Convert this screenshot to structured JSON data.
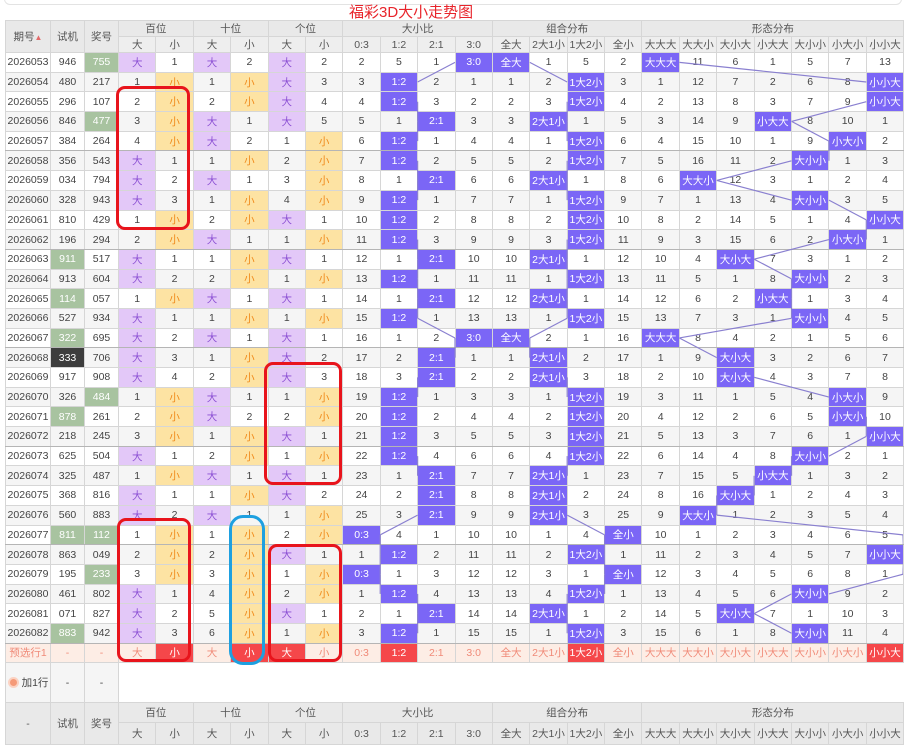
{
  "title": "福彩3D大小走势图",
  "colors": {
    "da_bg": "#e3c8f8",
    "xiao_bg": "#fde3a3",
    "hit": "#7b66f6",
    "pred_selected": "#f5474a",
    "highlight_green": "#a8c3a0",
    "line": "#8a80d0"
  },
  "header": {
    "period": "期号",
    "test": "试机",
    "prize": "奖号",
    "groups": {
      "bai": "百位",
      "shi": "十位",
      "ge": "个位",
      "ratio": "大小比",
      "combo": "组合分布",
      "form": "形态分布"
    },
    "da": "大",
    "xiao": "小",
    "ratio_cols": [
      "0:3",
      "1:2",
      "2:1",
      "3:0"
    ],
    "combo_cols": [
      "全大",
      "2大1小",
      "1大2小",
      "全小"
    ],
    "form_cols": [
      "大大大",
      "大大小",
      "大小大",
      "小大大",
      "大小小",
      "小大小",
      "小小大"
    ],
    "sort_icon": "sort-arrows-icon"
  },
  "rows": [
    {
      "p": "2026053",
      "t": "946",
      "z": "755",
      "zh": "g",
      "bai": [
        "大",
        "1"
      ],
      "shi": [
        "大",
        "2"
      ],
      "ge": [
        "大",
        "2"
      ],
      "ratio": [
        "2",
        "5",
        "1",
        "3:0"
      ],
      "combo": [
        "全大",
        "1",
        "5",
        "2"
      ],
      "form": [
        "大大大",
        "11",
        "6",
        "1",
        "5",
        "7",
        "13"
      ]
    },
    {
      "p": "2026054",
      "t": "480",
      "z": "217",
      "bai": [
        "1",
        "小"
      ],
      "shi": [
        "1",
        "小"
      ],
      "ge": [
        "大",
        "3"
      ],
      "ratio": [
        "3",
        "1:2",
        "2",
        "1"
      ],
      "combo": [
        "1",
        "2",
        "1大2小",
        "3"
      ],
      "form": [
        "1",
        "12",
        "7",
        "2",
        "6",
        "8",
        "小小大"
      ]
    },
    {
      "p": "2026055",
      "t": "296",
      "z": "107",
      "bai": [
        "2",
        "小"
      ],
      "shi": [
        "2",
        "小"
      ],
      "ge": [
        "大",
        "4"
      ],
      "ratio": [
        "4",
        "1:2",
        "3",
        "2"
      ],
      "combo": [
        "2",
        "3",
        "1大2小",
        "4"
      ],
      "form": [
        "2",
        "13",
        "8",
        "3",
        "7",
        "9",
        "小小大"
      ]
    },
    {
      "p": "2026056",
      "t": "846",
      "z": "477",
      "zh": "g",
      "bai": [
        "3",
        "小"
      ],
      "shi": [
        "大",
        "1"
      ],
      "ge": [
        "大",
        "5"
      ],
      "ratio": [
        "5",
        "1",
        "2:1",
        "3"
      ],
      "combo": [
        "3",
        "2大1小",
        "1",
        "5"
      ],
      "form": [
        "3",
        "14",
        "9",
        "小大大",
        "8",
        "10",
        "1"
      ]
    },
    {
      "p": "2026057",
      "t": "384",
      "z": "264",
      "bai": [
        "4",
        "小"
      ],
      "shi": [
        "大",
        "2"
      ],
      "ge": [
        "1",
        "小"
      ],
      "ratio": [
        "6",
        "1:2",
        "1",
        "4"
      ],
      "combo": [
        "4",
        "1",
        "1大2小",
        "6"
      ],
      "form": [
        "4",
        "15",
        "10",
        "1",
        "9",
        "小大小",
        "2"
      ]
    },
    {
      "p": "2026058",
      "t": "356",
      "z": "543",
      "bai": [
        "大",
        "1"
      ],
      "shi": [
        "1",
        "小"
      ],
      "ge": [
        "2",
        "小"
      ],
      "ratio": [
        "7",
        "1:2",
        "2",
        "5"
      ],
      "combo": [
        "5",
        "2",
        "1大2小",
        "7"
      ],
      "form": [
        "5",
        "16",
        "11",
        "2",
        "大小小",
        "1",
        "3"
      ]
    },
    {
      "p": "2026059",
      "t": "034",
      "z": "794",
      "bai": [
        "大",
        "2"
      ],
      "shi": [
        "大",
        "1"
      ],
      "ge": [
        "3",
        "小"
      ],
      "ratio": [
        "8",
        "1",
        "2:1",
        "6"
      ],
      "combo": [
        "6",
        "2大1小",
        "1",
        "8"
      ],
      "form": [
        "6",
        "大大小",
        "12",
        "3",
        "1",
        "2",
        "4"
      ]
    },
    {
      "p": "2026060",
      "t": "328",
      "z": "943",
      "bai": [
        "大",
        "3"
      ],
      "shi": [
        "1",
        "小"
      ],
      "ge": [
        "4",
        "小"
      ],
      "ratio": [
        "9",
        "1:2",
        "1",
        "7"
      ],
      "combo": [
        "7",
        "1",
        "1大2小",
        "9"
      ],
      "form": [
        "7",
        "1",
        "13",
        "4",
        "大小小",
        "3",
        "5"
      ]
    },
    {
      "p": "2026061",
      "t": "810",
      "z": "429",
      "bai": [
        "1",
        "小"
      ],
      "shi": [
        "2",
        "小"
      ],
      "ge": [
        "大",
        "1"
      ],
      "ratio": [
        "10",
        "1:2",
        "2",
        "8"
      ],
      "combo": [
        "8",
        "2",
        "1大2小",
        "10"
      ],
      "form": [
        "8",
        "2",
        "14",
        "5",
        "1",
        "4",
        "小小大"
      ]
    },
    {
      "p": "2026062",
      "t": "196",
      "z": "294",
      "bai": [
        "2",
        "小"
      ],
      "shi": [
        "大",
        "1"
      ],
      "ge": [
        "1",
        "小"
      ],
      "ratio": [
        "11",
        "1:2",
        "3",
        "9"
      ],
      "combo": [
        "9",
        "3",
        "1大2小",
        "11"
      ],
      "form": [
        "9",
        "3",
        "15",
        "6",
        "2",
        "小大小",
        "1"
      ]
    },
    {
      "p": "2026063",
      "t": "911",
      "th": "g",
      "z": "517",
      "bai": [
        "大",
        "1"
      ],
      "shi": [
        "1",
        "小"
      ],
      "ge": [
        "大",
        "1"
      ],
      "ratio": [
        "12",
        "1",
        "2:1",
        "10"
      ],
      "combo": [
        "10",
        "2大1小",
        "1",
        "12"
      ],
      "form": [
        "10",
        "4",
        "大小大",
        "7",
        "3",
        "1",
        "2"
      ]
    },
    {
      "p": "2026064",
      "t": "913",
      "z": "604",
      "bai": [
        "大",
        "2"
      ],
      "shi": [
        "2",
        "小"
      ],
      "ge": [
        "1",
        "小"
      ],
      "ratio": [
        "13",
        "1:2",
        "1",
        "11"
      ],
      "combo": [
        "11",
        "1",
        "1大2小",
        "13"
      ],
      "form": [
        "11",
        "5",
        "1",
        "8",
        "大小小",
        "2",
        "3"
      ]
    },
    {
      "p": "2026065",
      "t": "114",
      "th": "g",
      "z": "057",
      "bai": [
        "1",
        "小"
      ],
      "shi": [
        "大",
        "1"
      ],
      "ge": [
        "大",
        "1"
      ],
      "ratio": [
        "14",
        "1",
        "2:1",
        "12"
      ],
      "combo": [
        "12",
        "2大1小",
        "1",
        "14"
      ],
      "form": [
        "12",
        "6",
        "2",
        "小大大",
        "1",
        "3",
        "4"
      ]
    },
    {
      "p": "2026066",
      "t": "527",
      "z": "934",
      "bai": [
        "大",
        "1"
      ],
      "shi": [
        "1",
        "小"
      ],
      "ge": [
        "1",
        "小"
      ],
      "ratio": [
        "15",
        "1:2",
        "1",
        "13"
      ],
      "combo": [
        "13",
        "1",
        "1大2小",
        "15"
      ],
      "form": [
        "13",
        "7",
        "3",
        "1",
        "大小小",
        "4",
        "5"
      ]
    },
    {
      "p": "2026067",
      "t": "322",
      "th": "g",
      "z": "695",
      "bai": [
        "大",
        "2"
      ],
      "shi": [
        "大",
        "1"
      ],
      "ge": [
        "大",
        "1"
      ],
      "ratio": [
        "16",
        "1",
        "2",
        "3:0"
      ],
      "combo": [
        "全大",
        "2",
        "1",
        "16"
      ],
      "form": [
        "大大大",
        "8",
        "4",
        "2",
        "1",
        "5",
        "6"
      ]
    },
    {
      "p": "2026068",
      "t": "333",
      "th": "k",
      "z": "706",
      "bai": [
        "大",
        "3"
      ],
      "shi": [
        "1",
        "小"
      ],
      "ge": [
        "大",
        "2"
      ],
      "ratio": [
        "17",
        "2",
        "2:1",
        "1"
      ],
      "combo": [
        "1",
        "2大1小",
        "2",
        "17"
      ],
      "form": [
        "1",
        "9",
        "大小大",
        "3",
        "2",
        "6",
        "7"
      ]
    },
    {
      "p": "2026069",
      "t": "917",
      "z": "908",
      "bai": [
        "大",
        "4"
      ],
      "shi": [
        "2",
        "小"
      ],
      "ge": [
        "大",
        "3"
      ],
      "ratio": [
        "18",
        "3",
        "2:1",
        "2"
      ],
      "combo": [
        "2",
        "2大1小",
        "3",
        "18"
      ],
      "form": [
        "2",
        "10",
        "大小大",
        "4",
        "3",
        "7",
        "8"
      ]
    },
    {
      "p": "2026070",
      "t": "326",
      "z": "484",
      "zh": "g",
      "bai": [
        "1",
        "小"
      ],
      "shi": [
        "大",
        "1"
      ],
      "ge": [
        "1",
        "小"
      ],
      "ratio": [
        "19",
        "1:2",
        "1",
        "3"
      ],
      "combo": [
        "3",
        "1",
        "1大2小",
        "19"
      ],
      "form": [
        "3",
        "11",
        "1",
        "5",
        "4",
        "小大小",
        "9"
      ]
    },
    {
      "p": "2026071",
      "t": "878",
      "th": "g",
      "z": "261",
      "bai": [
        "2",
        "小"
      ],
      "shi": [
        "大",
        "2"
      ],
      "ge": [
        "2",
        "小"
      ],
      "ratio": [
        "20",
        "1:2",
        "2",
        "4"
      ],
      "combo": [
        "4",
        "2",
        "1大2小",
        "20"
      ],
      "form": [
        "4",
        "12",
        "2",
        "6",
        "5",
        "小大小",
        "10"
      ]
    },
    {
      "p": "2026072",
      "t": "218",
      "z": "245",
      "bai": [
        "3",
        "小"
      ],
      "shi": [
        "1",
        "小"
      ],
      "ge": [
        "大",
        "1"
      ],
      "ratio": [
        "21",
        "1:2",
        "3",
        "5"
      ],
      "combo": [
        "5",
        "3",
        "1大2小",
        "21"
      ],
      "form": [
        "5",
        "13",
        "3",
        "7",
        "6",
        "1",
        "小小大"
      ]
    },
    {
      "p": "2026073",
      "t": "625",
      "z": "504",
      "bai": [
        "大",
        "1"
      ],
      "shi": [
        "2",
        "小"
      ],
      "ge": [
        "1",
        "小"
      ],
      "ratio": [
        "22",
        "1:2",
        "4",
        "6"
      ],
      "combo": [
        "6",
        "4",
        "1大2小",
        "22"
      ],
      "form": [
        "6",
        "14",
        "4",
        "8",
        "大小小",
        "2",
        "1"
      ]
    },
    {
      "p": "2026074",
      "t": "325",
      "z": "487",
      "bai": [
        "1",
        "小"
      ],
      "shi": [
        "大",
        "1"
      ],
      "ge": [
        "大",
        "1"
      ],
      "ratio": [
        "23",
        "1",
        "2:1",
        "7"
      ],
      "combo": [
        "7",
        "2大1小",
        "1",
        "23"
      ],
      "form": [
        "7",
        "15",
        "5",
        "小大大",
        "1",
        "3",
        "2"
      ]
    },
    {
      "p": "2026075",
      "t": "368",
      "z": "816",
      "bai": [
        "大",
        "1"
      ],
      "shi": [
        "1",
        "小"
      ],
      "ge": [
        "大",
        "2"
      ],
      "ratio": [
        "24",
        "2",
        "2:1",
        "8"
      ],
      "combo": [
        "8",
        "2大1小",
        "2",
        "24"
      ],
      "form": [
        "8",
        "16",
        "大小大",
        "1",
        "2",
        "4",
        "3"
      ]
    },
    {
      "p": "2026076",
      "t": "560",
      "z": "883",
      "bai": [
        "大",
        "2"
      ],
      "shi": [
        "大",
        "1"
      ],
      "ge": [
        "1",
        "小"
      ],
      "ratio": [
        "25",
        "3",
        "2:1",
        "9"
      ],
      "combo": [
        "9",
        "2大1小",
        "3",
        "25"
      ],
      "form": [
        "9",
        "大大小",
        "1",
        "2",
        "3",
        "5",
        "4"
      ]
    },
    {
      "p": "2026077",
      "t": "811",
      "th": "g",
      "z": "112",
      "zh": "g",
      "bai": [
        "1",
        "小"
      ],
      "shi": [
        "1",
        "小"
      ],
      "ge": [
        "2",
        "小"
      ],
      "ratio": [
        "0:3",
        "4",
        "1",
        "10"
      ],
      "combo": [
        "10",
        "1",
        "4",
        "全小"
      ],
      "form": [
        "10",
        "1",
        "2",
        "3",
        "4",
        "6",
        "5"
      ]
    },
    {
      "p": "2026078",
      "t": "863",
      "z": "049",
      "bai": [
        "2",
        "小"
      ],
      "shi": [
        "2",
        "小"
      ],
      "ge": [
        "大",
        "1"
      ],
      "ratio": [
        "1",
        "1:2",
        "2",
        "11"
      ],
      "combo": [
        "11",
        "2",
        "1大2小",
        "1"
      ],
      "form": [
        "11",
        "2",
        "3",
        "4",
        "5",
        "7",
        "小小大"
      ]
    },
    {
      "p": "2026079",
      "t": "195",
      "z": "233",
      "zh": "g",
      "bai": [
        "3",
        "小"
      ],
      "shi": [
        "3",
        "小"
      ],
      "ge": [
        "1",
        "小"
      ],
      "ratio": [
        "0:3",
        "1",
        "3",
        "12"
      ],
      "combo": [
        "12",
        "3",
        "1",
        "全小"
      ],
      "form": [
        "12",
        "3",
        "4",
        "5",
        "6",
        "8",
        "1"
      ]
    },
    {
      "p": "2026080",
      "t": "461",
      "z": "802",
      "bai": [
        "大",
        "1"
      ],
      "shi": [
        "4",
        "小"
      ],
      "ge": [
        "2",
        "小"
      ],
      "ratio": [
        "1",
        "1:2",
        "4",
        "13"
      ],
      "combo": [
        "13",
        "4",
        "1大2小",
        "1"
      ],
      "form": [
        "13",
        "4",
        "5",
        "6",
        "大小小",
        "9",
        "2"
      ]
    },
    {
      "p": "2026081",
      "t": "071",
      "z": "827",
      "bai": [
        "大",
        "2"
      ],
      "shi": [
        "5",
        "小"
      ],
      "ge": [
        "大",
        "1"
      ],
      "ratio": [
        "2",
        "1",
        "2:1",
        "14"
      ],
      "combo": [
        "14",
        "2大1小",
        "1",
        "2"
      ],
      "form": [
        "14",
        "5",
        "大小大",
        "7",
        "1",
        "10",
        "3"
      ]
    },
    {
      "p": "2026082",
      "t": "883",
      "th": "g",
      "z": "942",
      "bai": [
        "大",
        "3"
      ],
      "shi": [
        "6",
        "小"
      ],
      "ge": [
        "1",
        "小"
      ],
      "ratio": [
        "3",
        "1:2",
        "1",
        "15"
      ],
      "combo": [
        "15",
        "1",
        "1大2小",
        "3"
      ],
      "form": [
        "15",
        "6",
        "1",
        "8",
        "大小小",
        "11",
        "4"
      ]
    }
  ],
  "prediction": {
    "label": "预选行1",
    "test": "-",
    "prize": "-",
    "cells": [
      "大",
      "小",
      "大",
      "小",
      "大",
      "小",
      "0:3",
      "1:2",
      "2:1",
      "3:0",
      "全大",
      "2大1小",
      "1大2小",
      "全小",
      "大大大",
      "大大小",
      "大小大",
      "小大大",
      "大小小",
      "小大小",
      "小小大"
    ],
    "selected": [
      false,
      true,
      false,
      true,
      true,
      false,
      false,
      true,
      false,
      false,
      false,
      false,
      true,
      false,
      false,
      false,
      false,
      false,
      false,
      false,
      true
    ]
  },
  "add_row": {
    "label": "加1行",
    "test": "-",
    "prize": "-",
    "icon": "plus-circle-icon"
  },
  "footer": {
    "first": "-"
  }
}
